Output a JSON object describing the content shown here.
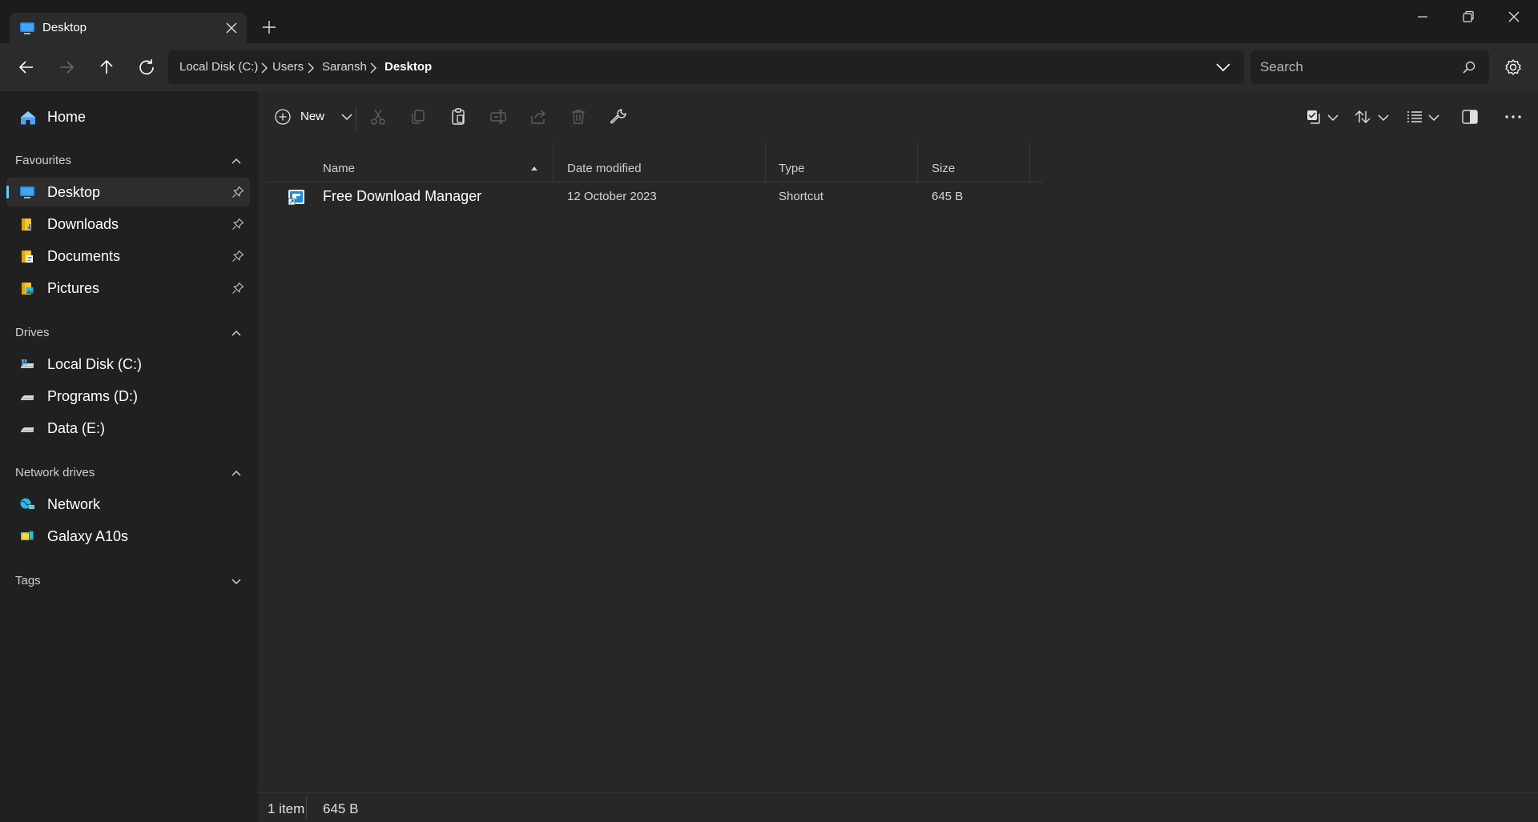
{
  "window": {
    "tab_title": "Desktop"
  },
  "address": {
    "breadcrumbs": [
      "Local Disk (C:)",
      "Users",
      "Saransh",
      "Desktop"
    ],
    "search_placeholder": "Search"
  },
  "sidebar": {
    "home_label": "Home",
    "favourites": {
      "header": "Favourites",
      "items": [
        {
          "label": "Desktop",
          "icon": "desktop-icon",
          "selected": true
        },
        {
          "label": "Downloads",
          "icon": "downloads-folder-icon"
        },
        {
          "label": "Documents",
          "icon": "documents-folder-icon"
        },
        {
          "label": "Pictures",
          "icon": "pictures-folder-icon"
        }
      ]
    },
    "drives": {
      "header": "Drives",
      "items": [
        {
          "label": "Local Disk (C:)",
          "icon": "windows-drive-icon"
        },
        {
          "label": "Programs (D:)",
          "icon": "drive-icon"
        },
        {
          "label": "Data (E:)",
          "icon": "drive-icon"
        }
      ]
    },
    "network_drives": {
      "header": "Network drives",
      "items": [
        {
          "label": "Network",
          "icon": "network-icon"
        },
        {
          "label": "Galaxy A10s",
          "icon": "phone-icon"
        }
      ]
    },
    "tags": {
      "header": "Tags"
    }
  },
  "toolbar": {
    "new_label": "New"
  },
  "file_list": {
    "columns": [
      "Name",
      "Date modified",
      "Type",
      "Size"
    ],
    "sort_column": "Name",
    "sort_direction": "ascending",
    "rows": [
      {
        "name": "Free Download Manager",
        "date_modified": "12 October 2023",
        "type": "Shortcut",
        "size": "645 B"
      }
    ]
  },
  "status": {
    "item_count": "1 item",
    "total_size": "645 B"
  },
  "colors": {
    "accent": "#60cdff",
    "background": "#202020",
    "panel": "#272727"
  }
}
